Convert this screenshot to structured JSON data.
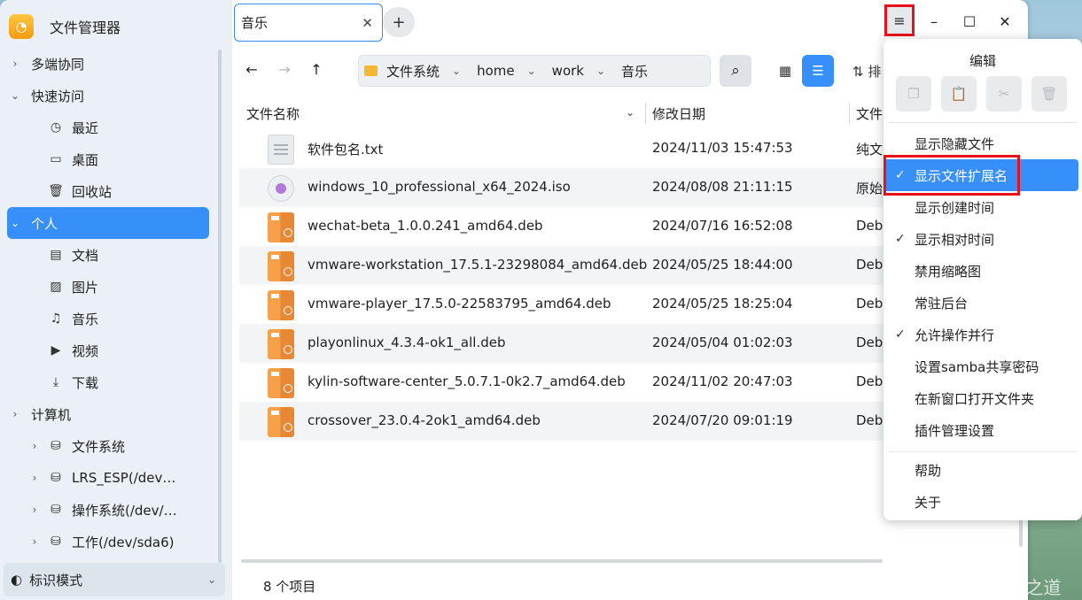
{
  "app": {
    "title": "文件管理器",
    "logo_glyph": "◔"
  },
  "sidebar": {
    "items": [
      {
        "label": "多端协同",
        "level": 0,
        "chevron": "›",
        "icon": ""
      },
      {
        "label": "快速访问",
        "level": 0,
        "chevron": "⌄",
        "icon": ""
      },
      {
        "label": "最近",
        "level": 1,
        "chevron": "",
        "icon": "◷"
      },
      {
        "label": "桌面",
        "level": 1,
        "chevron": "",
        "icon": "▭"
      },
      {
        "label": "回收站",
        "level": 1,
        "chevron": "",
        "icon": "🗑"
      },
      {
        "label": "个人",
        "level": 0,
        "chevron": "⌄",
        "icon": "",
        "active": true
      },
      {
        "label": "文档",
        "level": 1,
        "chevron": "",
        "icon": "▤"
      },
      {
        "label": "图片",
        "level": 1,
        "chevron": "",
        "icon": "▨"
      },
      {
        "label": "音乐",
        "level": 1,
        "chevron": "",
        "icon": "♫"
      },
      {
        "label": "视频",
        "level": 1,
        "chevron": "",
        "icon": "▶"
      },
      {
        "label": "下载",
        "level": 1,
        "chevron": "",
        "icon": "⤓"
      },
      {
        "label": "计算机",
        "level": 0,
        "chevron": "›",
        "icon": ""
      },
      {
        "label": "文件系统",
        "level": 1,
        "chevron": "›",
        "icon": "⛁"
      },
      {
        "label": "LRS_ESP(/dev…",
        "level": 1,
        "chevron": "›",
        "icon": "⛁"
      },
      {
        "label": "操作系统(/dev/…",
        "level": 1,
        "chevron": "›",
        "icon": "⛁"
      },
      {
        "label": "工作(/dev/sda6)",
        "level": 1,
        "chevron": "›",
        "icon": "⛁"
      }
    ],
    "mode": {
      "label": "标识模式",
      "icon": "◐",
      "arrow": "⌄"
    }
  },
  "tab": {
    "label": "音乐",
    "close": "✕",
    "new": "+"
  },
  "window_controls": {
    "menu": "≡",
    "minimize": "–",
    "maximize": "☐",
    "close": "✕"
  },
  "toolbar": {
    "back": "←",
    "forward": "→",
    "up": "↑",
    "breadcrumbs": [
      "文件系统",
      "home",
      "work",
      "音乐"
    ],
    "crumb_sep": "⌄",
    "search": "⌕",
    "icon_view": "▦",
    "list_view": "☰",
    "sort": "⇅ 排"
  },
  "columns": {
    "name": "文件名称",
    "modified": "修改日期",
    "type": "文件",
    "name_chevron": "⌄"
  },
  "files": [
    {
      "name": "软件包名.txt",
      "date": "2024/11/03 15:47:53",
      "type": "纯文",
      "kind": "txt"
    },
    {
      "name": "windows_10_professional_x64_2024.iso",
      "date": "2024/08/08 21:11:15",
      "type": "原始",
      "kind": "iso"
    },
    {
      "name": "wechat-beta_1.0.0.241_amd64.deb",
      "date": "2024/07/16 16:52:08",
      "type": "Debi",
      "kind": "deb"
    },
    {
      "name": "vmware-workstation_17.5.1-23298084_amd64.deb",
      "date": "2024/05/25 18:44:00",
      "type": "Debi",
      "kind": "deb"
    },
    {
      "name": "vmware-player_17.5.0-22583795_amd64.deb",
      "date": "2024/05/25 18:25:04",
      "type": "Debi",
      "kind": "deb"
    },
    {
      "name": "playonlinux_4.3.4-ok1_all.deb",
      "date": "2024/05/04 01:02:03",
      "type": "Debi",
      "kind": "deb"
    },
    {
      "name": "kylin-software-center_5.0.7.1-0k2.7_amd64.deb",
      "date": "2024/11/02 20:47:03",
      "type": "Debi",
      "kind": "deb"
    },
    {
      "name": "crossover_23.0.4-2ok1_amd64.deb",
      "date": "2024/07/20 09:01:19",
      "type": "Debi",
      "kind": "deb"
    }
  ],
  "status": {
    "count": "8 个项目"
  },
  "menu": {
    "title": "编辑",
    "edit_buttons": [
      {
        "name": "copy",
        "icon": "❐"
      },
      {
        "name": "paste",
        "icon": "📋"
      },
      {
        "name": "cut",
        "icon": "✂"
      },
      {
        "name": "delete",
        "icon": "🗑"
      }
    ],
    "items": [
      {
        "label": "显示隐藏文件",
        "checked": false
      },
      {
        "label": "显示文件扩展名",
        "checked": true,
        "highlight": true
      },
      {
        "label": "显示创建时间",
        "checked": false
      },
      {
        "label": "显示相对时间",
        "checked": true
      },
      {
        "label": "禁用缩略图",
        "checked": false
      },
      {
        "label": "常驻后台",
        "checked": false
      },
      {
        "label": "允许操作并行",
        "checked": true
      },
      {
        "label": "设置samba共享密码",
        "checked": false
      },
      {
        "label": "在新窗口打开文件夹",
        "checked": false
      },
      {
        "label": "插件管理设置",
        "checked": false
      }
    ],
    "footer_items": [
      {
        "label": "帮助"
      },
      {
        "label": "关于"
      }
    ],
    "check_glyph": "✓"
  },
  "watermark": "CSDN @学思之道",
  "colors": {
    "accent": "#3790fa",
    "annotation_red": "#e8101a"
  }
}
